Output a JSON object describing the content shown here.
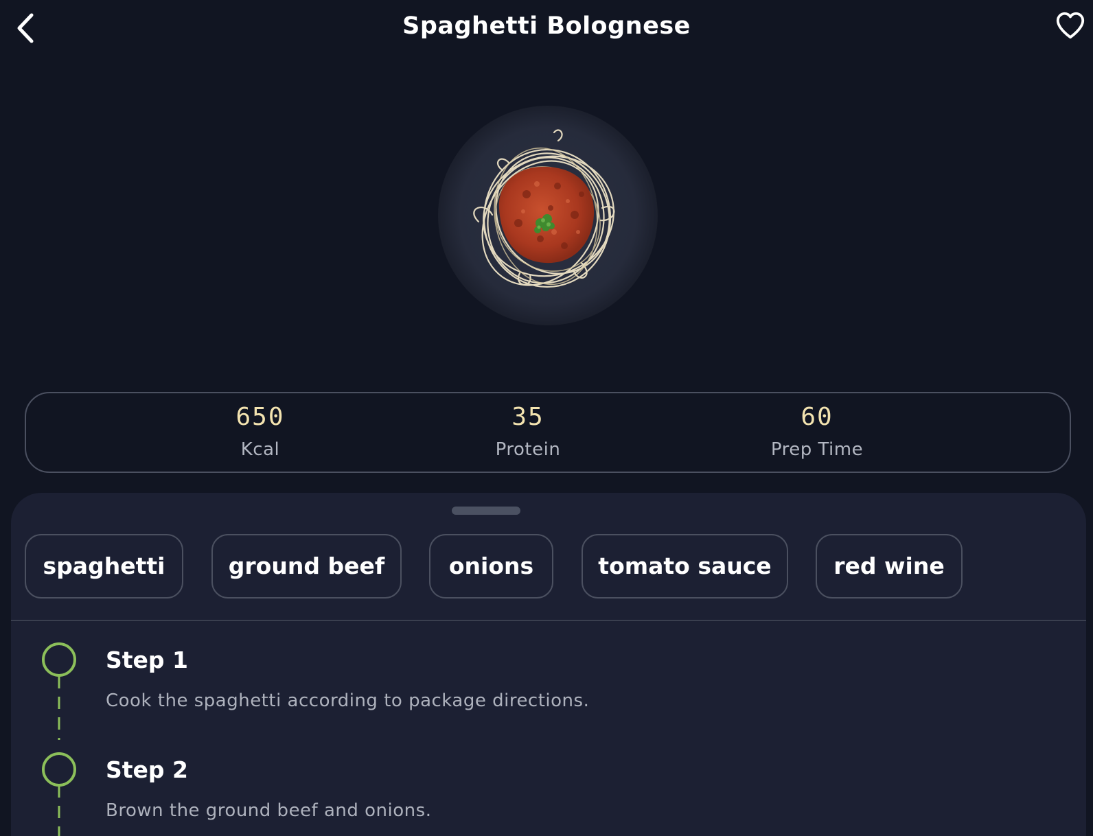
{
  "header": {
    "title": "Spaghetti Bolognese",
    "back_icon": "chevron-left-icon",
    "favorite_icon": "heart-outline-icon"
  },
  "dish_image": {
    "subject": "spaghetti bolognese on dark plate"
  },
  "stats": [
    {
      "value": "650",
      "label": "Kcal"
    },
    {
      "value": "35",
      "label": "Protein"
    },
    {
      "value": "60",
      "label": "Prep Time"
    }
  ],
  "ingredients": [
    "spaghetti",
    "ground beef",
    "onions",
    "tomato sauce",
    "red wine"
  ],
  "steps": [
    {
      "title": "Step 1",
      "description": "Cook the spaghetti according to package directions."
    },
    {
      "title": "Step 2",
      "description": "Brown the ground beef and onions."
    }
  ],
  "colors": {
    "background": "#111522",
    "sheet": "#1c2033",
    "accent_green": "#8cbf5a",
    "stat_value": "#f3e3b0",
    "border": "#4b5060"
  }
}
